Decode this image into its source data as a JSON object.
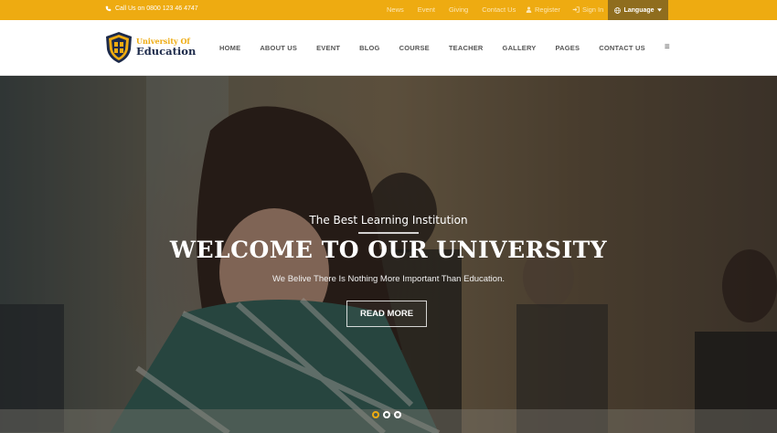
{
  "topbar": {
    "phone": "Call Us on 0800 123 46 4747",
    "links": [
      "News",
      "Event",
      "Giving",
      "Contact Us"
    ],
    "register": "Register",
    "signin": "Sign In",
    "language": "Language"
  },
  "logo": {
    "line1": "University Of",
    "line2": "Education"
  },
  "nav": {
    "items": [
      "HOME",
      "ABOUT US",
      "EVENT",
      "BLOG",
      "COURSE",
      "TEACHER",
      "GALLERY",
      "PAGES",
      "CONTACT US"
    ],
    "menu_icon": "≡"
  },
  "hero": {
    "subtitle": "The Best Learning Institution",
    "title": "WELCOME TO OUR UNIVERSITY",
    "tagline": "We Belive There Is Nothing More Important Than Education.",
    "button": "READ MORE",
    "slides": 3,
    "active_slide": 1
  },
  "colors": {
    "accent": "#eeab11",
    "topbar_dark": "#8f6d1e",
    "navy": "#1d2a4a"
  },
  "icons": [
    "phone-icon",
    "user-icon",
    "sign-in-icon",
    "globe-icon",
    "caret-down-icon",
    "shield-logo-icon",
    "hamburger-menu-icon"
  ]
}
